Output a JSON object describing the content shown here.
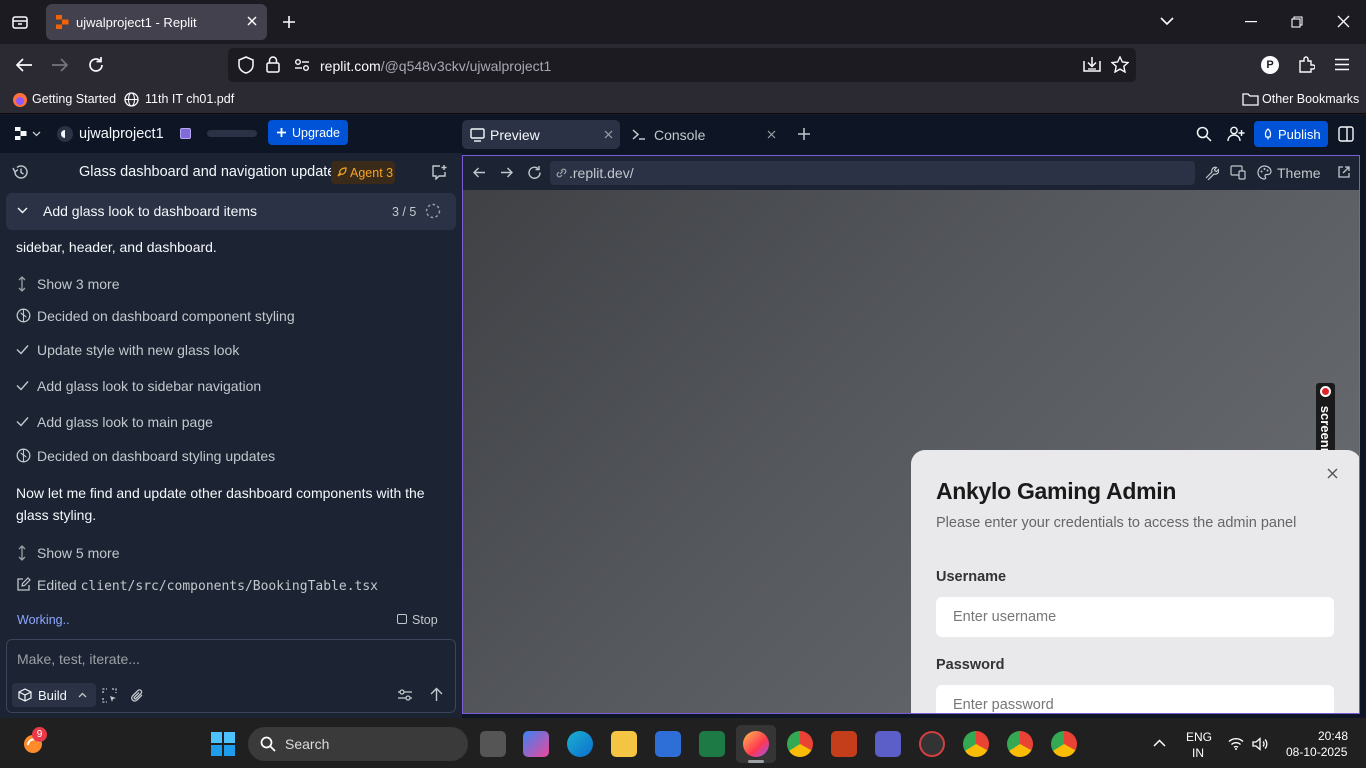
{
  "browser": {
    "tab_title": "ujwalproject1 - Replit",
    "url_host": "replit.com",
    "url_path": "/@q548v3ckv/ujwalproject1",
    "bookmarks": {
      "getting_started": "Getting Started",
      "pdf": "11th IT ch01.pdf",
      "other": "Other Bookmarks"
    },
    "profile_letter": "P"
  },
  "replit": {
    "project_name": "ujwalproject1",
    "upgrade_label": "Upgrade",
    "tabs": [
      {
        "label": "Preview"
      },
      {
        "label": "Console"
      }
    ],
    "publish_label": "Publish",
    "chat_title": "Glass dashboard and navigation update",
    "agent_badge": "Agent 3",
    "task": {
      "title": "Add glass look to dashboard items",
      "progress": "3 / 5"
    },
    "log": {
      "line1": "sidebar, header, and dashboard.",
      "show_more_1": "Show 3 more",
      "decided_1": "Decided on dashboard component styling",
      "check_1": "Update style with new glass look",
      "check_2": "Add glass look to sidebar navigation",
      "check_3": "Add glass look to main page",
      "decided_2": "Decided on dashboard styling updates",
      "paragraph_1": "Now let me find and update other dashboard components with the",
      "paragraph_2": "glass styling.",
      "show_more_2": "Show 5 more",
      "edited_prefix": "Edited",
      "edited_file": "client/src/components/BookingTable.tsx"
    },
    "status": "Working..",
    "stop_label": "Stop",
    "input_placeholder": "Make, test, iterate...",
    "build_label": "Build",
    "preview_url": ".replit.dev/",
    "theme_label": "Theme"
  },
  "app": {
    "title": "Ankylo Gaming Admin",
    "subtitle": "Please enter your credentials to access the admin panel",
    "username_label": "Username",
    "username_placeholder": "Enter username",
    "password_label": "Password",
    "password_placeholder": "Enter password",
    "overlay_text": "screenrec"
  },
  "taskbar": {
    "search_label": "Search",
    "badge_count": "9",
    "lang_1": "ENG",
    "lang_2": "IN",
    "time": "20:48",
    "date": "08-10-2025"
  },
  "colors": {
    "accent": "#0053d6",
    "agent_orange": "#f5a623",
    "preview_border": "#7d5bd6"
  }
}
